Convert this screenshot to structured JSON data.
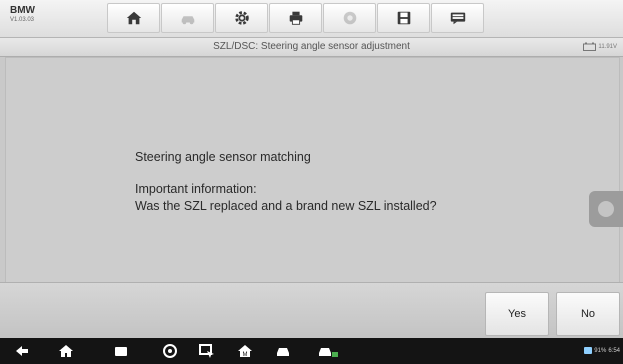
{
  "header": {
    "brand": "BMW",
    "version": "V1.03.03"
  },
  "toolbar": {
    "items": [
      {
        "icon": "home-icon",
        "enabled": true
      },
      {
        "icon": "vehicle-swap-icon",
        "enabled": false
      },
      {
        "icon": "gear-icon",
        "enabled": true
      },
      {
        "icon": "printer-icon",
        "enabled": true
      },
      {
        "icon": "help-icon",
        "enabled": false
      },
      {
        "icon": "save-icon",
        "enabled": true
      },
      {
        "icon": "datalogging-icon",
        "enabled": true
      }
    ]
  },
  "titlebar": {
    "title": "SZL/DSC: Steering angle sensor adjustment",
    "battery_voltage": "11.91V"
  },
  "message": {
    "line1": "Steering angle sensor matching",
    "line2": "Important information:",
    "line3": "Was the SZL replaced and a brand new SZL installed?"
  },
  "actions": {
    "yes_label": "Yes",
    "no_label": "No"
  },
  "system_bar": {
    "battery_text": "91%",
    "time": "6:54"
  },
  "colors": {
    "background": "#c9c9c9",
    "navbar": "#141414"
  }
}
